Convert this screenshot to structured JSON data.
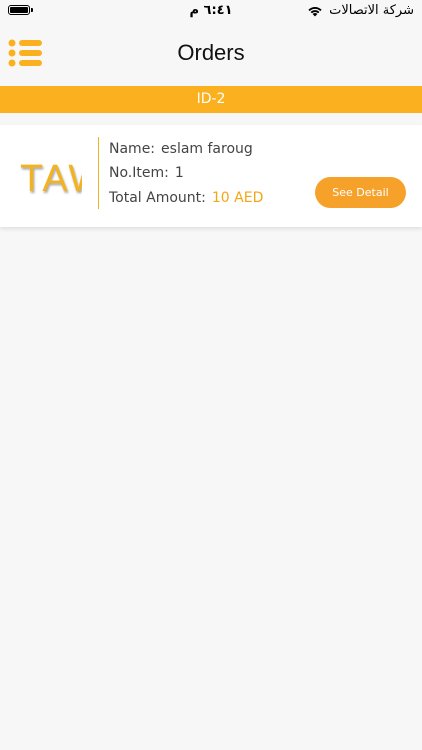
{
  "status_bar": {
    "time": "٦:٤١ م",
    "carrier": "شركة الاتصالات"
  },
  "nav": {
    "title": "Orders",
    "menu_icon": "list-menu-icon"
  },
  "order": {
    "id": "ID-2",
    "logo_text": "TAW",
    "name_label": "Name:",
    "name_value": "eslam faroug",
    "items_label": "No.Item:",
    "items_value": "1",
    "amount_label": "Total Amount:",
    "amount_value": "10 AED",
    "detail_button": "See Detail"
  },
  "colors": {
    "accent": "#fbb11f",
    "button": "#f6a22a",
    "background": "#f7f7f7"
  }
}
